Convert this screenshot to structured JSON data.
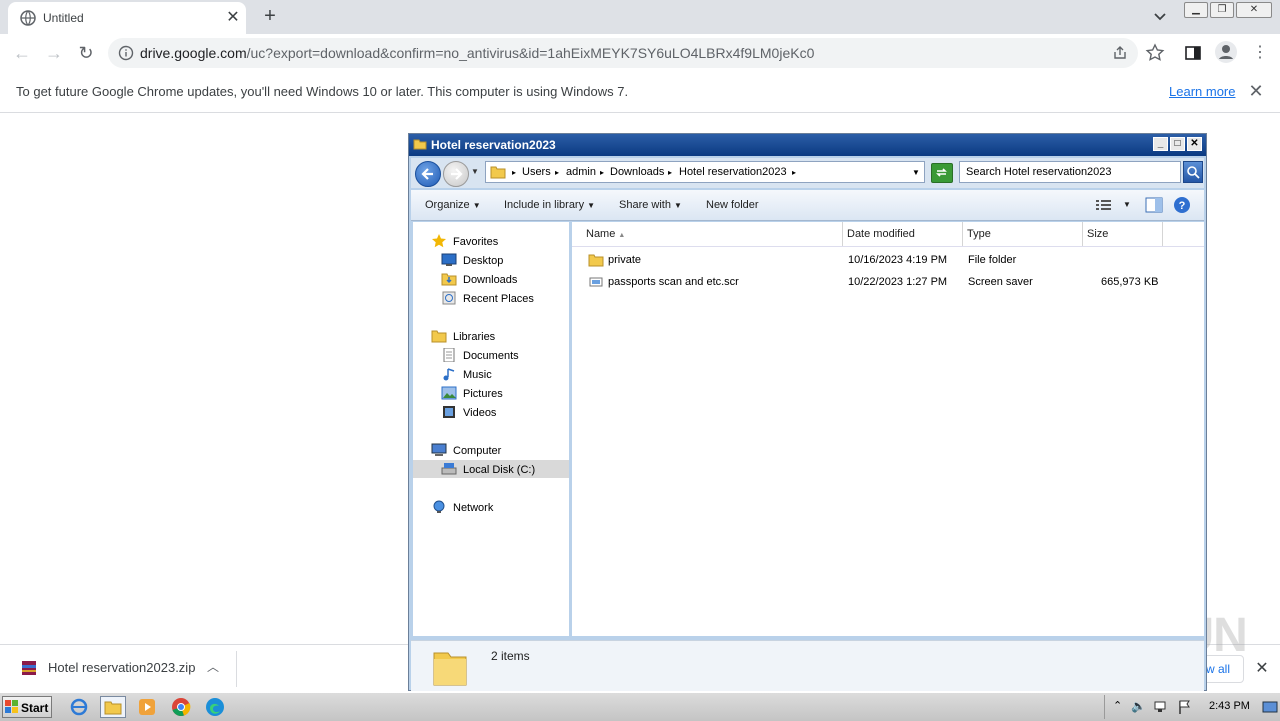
{
  "browser": {
    "tab_title": "Untitled",
    "url_host": "drive.google.com",
    "url_path": "/uc?export=download&confirm=no_antivirus&id=1ahEixMEYK7SY6uLO4LBRx4f9LM0jeKc0",
    "infobar_text": "To get future Google Chrome updates, you'll need Windows 10 or later. This computer is using Windows 7.",
    "learn_more": "Learn more"
  },
  "download_shelf": {
    "file_name": "Hotel reservation2023.zip",
    "show_all": "w all"
  },
  "explorer": {
    "title": "Hotel reservation2023",
    "breadcrumb": [
      "Users",
      "admin",
      "Downloads",
      "Hotel reservation2023"
    ],
    "search_placeholder": "Search Hotel reservation2023",
    "commands": {
      "organize": "Organize",
      "include_in_library": "Include in library",
      "share_with": "Share with",
      "new_folder": "New folder"
    },
    "nav": {
      "favorites": "Favorites",
      "desktop": "Desktop",
      "downloads": "Downloads",
      "recent_places": "Recent Places",
      "libraries": "Libraries",
      "documents": "Documents",
      "music": "Music",
      "pictures": "Pictures",
      "videos": "Videos",
      "computer": "Computer",
      "local_disk": "Local Disk (C:)",
      "network": "Network"
    },
    "columns": {
      "name": "Name",
      "date_modified": "Date modified",
      "type": "Type",
      "size": "Size"
    },
    "files": [
      {
        "name": "private",
        "date": "10/16/2023 4:19 PM",
        "type": "File folder",
        "size": ""
      },
      {
        "name": "passports scan and etc.scr",
        "date": "10/22/2023 1:27 PM",
        "type": "Screen saver",
        "size": "665,973 KB"
      }
    ],
    "status": "2 items"
  },
  "taskbar": {
    "start": "Start",
    "clock": "2:43 PM"
  },
  "watermark": "ANY RUN"
}
